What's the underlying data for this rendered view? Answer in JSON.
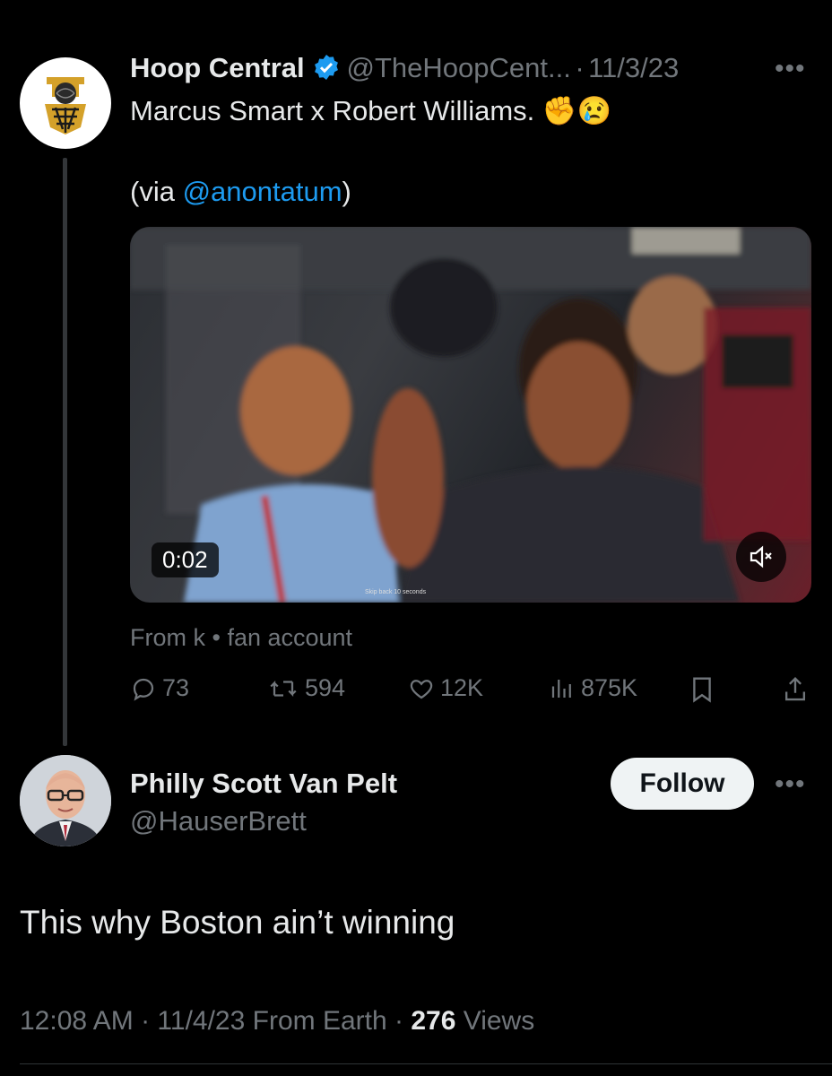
{
  "original_tweet": {
    "author_name": "Hoop Central",
    "handle": "@TheHoopCent...",
    "separator": "·",
    "date": "11/3/23",
    "text_line1": "Marcus Smart x Robert Williams.",
    "emoji": "✊😢",
    "via_prefix": "(via ",
    "via_handle": "@anontatum",
    "via_suffix": ")",
    "more": "•••",
    "video": {
      "duration": "0:02",
      "overlay_caption": "Skip back 10 seconds"
    },
    "source": "From k • fan account",
    "stats": {
      "replies": "73",
      "reposts": "594",
      "likes": "12K",
      "views": "875K"
    }
  },
  "reply": {
    "author_name": "Philly Scott Van Pelt",
    "handle": "@HauserBrett",
    "follow_label": "Follow",
    "more": "•••",
    "text": "This why Boston ain’t winning",
    "time": "12:08 AM",
    "date_source": " · 11/4/23 From Earth · ",
    "views_count": "276",
    "views_label": " Views"
  },
  "colors": {
    "background": "#000000",
    "text": "#e7e9ea",
    "muted": "#71767b",
    "link": "#1d9bf0",
    "verified": "#1d9bf0",
    "logo_gold": "#d4a12a"
  }
}
